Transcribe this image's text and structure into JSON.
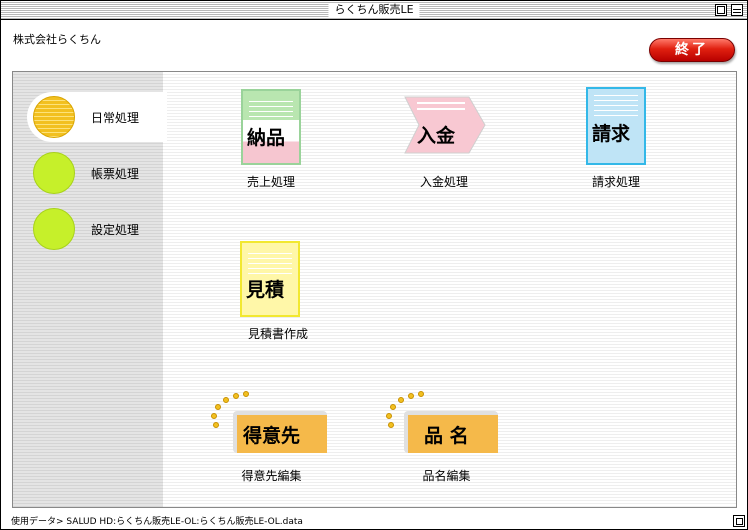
{
  "window": {
    "title": "らくちん販売LE"
  },
  "header": {
    "company": "株式会社らくちん",
    "quit_label": "終了"
  },
  "sidebar": {
    "items": [
      {
        "label": "日常処理",
        "active": true
      },
      {
        "label": "帳票処理",
        "active": false
      },
      {
        "label": "設定処理",
        "active": false
      }
    ]
  },
  "tiles": {
    "sales": {
      "icon_text": "納品",
      "caption": "売上処理"
    },
    "deposit": {
      "icon_text": "入金",
      "caption": "入金処理"
    },
    "billing": {
      "icon_text": "請求",
      "caption": "請求処理"
    },
    "estimate": {
      "icon_text": "見積",
      "caption": "見積書作成"
    },
    "customer": {
      "icon_text": "得意先",
      "caption": "得意先編集"
    },
    "product": {
      "icon_text": "品 名",
      "caption": "品名編集"
    }
  },
  "status": {
    "text": "使用データ> SALUD HD:らくちん販売LE-OL:らくちん販売LE-OL.data"
  },
  "colors": {
    "quit": "#e02010",
    "active_dot": "#f2c020",
    "inactive_dot": "#c6f02a",
    "label_tag": "#f5b94a"
  }
}
